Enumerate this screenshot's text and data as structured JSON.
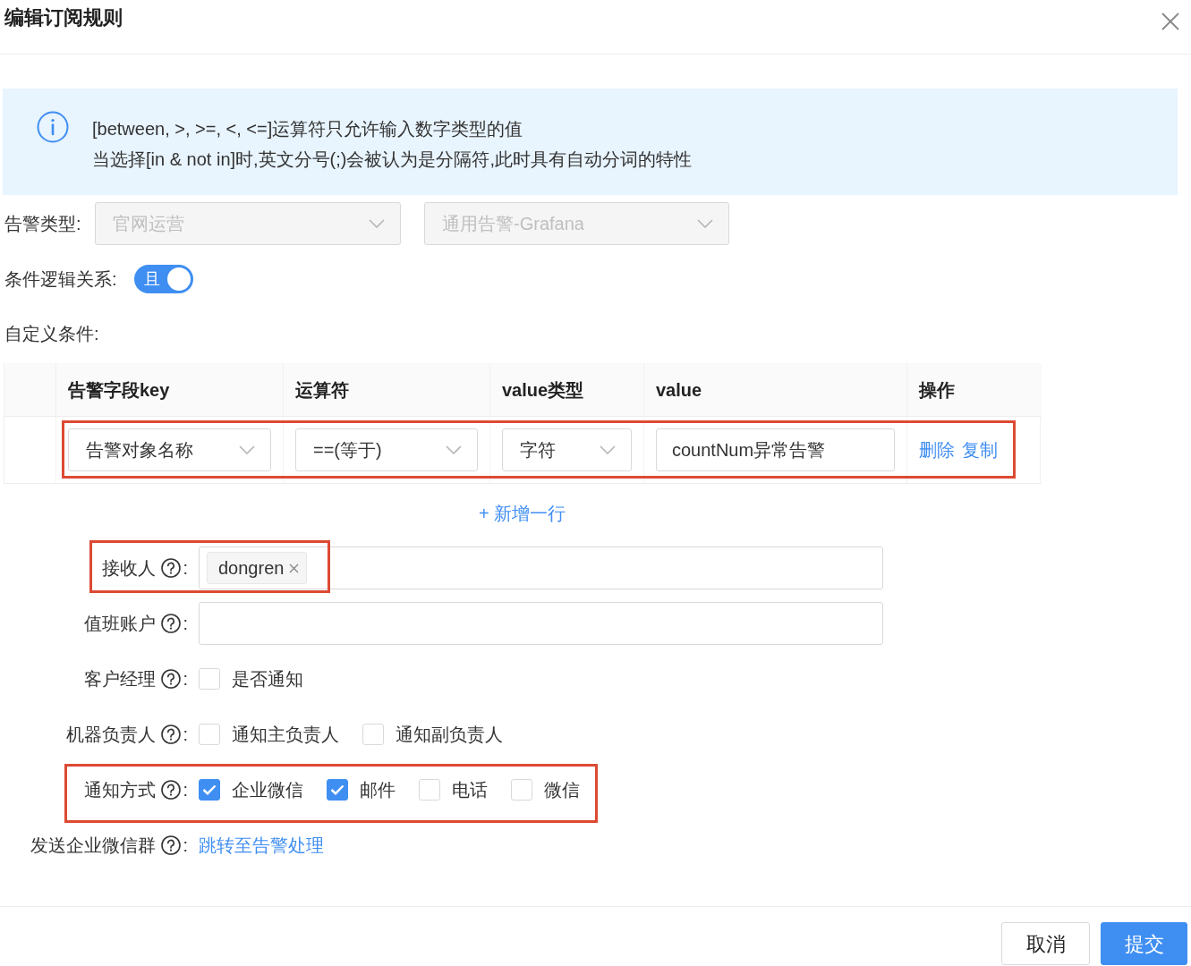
{
  "dialog": {
    "title": "编辑订阅规则"
  },
  "alert": {
    "lines": [
      "[between, >, >=, <, <=]运算符只允许输入数字类型的值",
      "当选择[in & not in]时,英文分号(;)会被认为是分隔符,此时具有自动分词的特性"
    ]
  },
  "alert_type": {
    "label": "告警类型:",
    "selects": [
      {
        "value": "官网运营",
        "disabled": true
      },
      {
        "value": "通用告警-Grafana",
        "disabled": true
      }
    ]
  },
  "logic": {
    "label": "条件逻辑关系:",
    "switch": {
      "text": "且",
      "on": true
    }
  },
  "conditions": {
    "label": "自定义条件:",
    "columns": [
      "告警字段key",
      "运算符",
      "value类型",
      "value",
      "操作"
    ],
    "rows": [
      {
        "highlighted": true,
        "field": "告警对象名称",
        "operator": "==(等于)",
        "value_type": "字符",
        "value": "countNum异常告警",
        "actions": [
          "删除",
          "复制"
        ]
      }
    ],
    "add_row": "+ 新增一行"
  },
  "form": [
    {
      "kind": "tags",
      "label": "接收人",
      "suffix": ":",
      "highlighted": true,
      "tags": [
        "dongren"
      ]
    },
    {
      "kind": "input",
      "label": "值班账户",
      "suffix": ":",
      "highlighted": false
    },
    {
      "kind": "checkboxes",
      "label": "客户经理",
      "suffix": ":",
      "highlighted": false,
      "options": [
        {
          "label": "是否通知",
          "checked": false
        }
      ]
    },
    {
      "kind": "checkboxes",
      "label": "机器负责人",
      "suffix": ":",
      "highlighted": false,
      "options": [
        {
          "label": "通知主负责人",
          "checked": false
        },
        {
          "label": "通知副负责人",
          "checked": false
        }
      ]
    },
    {
      "kind": "checkboxes",
      "label": "通知方式",
      "suffix": ":",
      "highlighted": true,
      "options": [
        {
          "label": "企业微信",
          "checked": true
        },
        {
          "label": "邮件",
          "checked": true
        },
        {
          "label": "电话",
          "checked": false
        },
        {
          "label": "微信",
          "checked": false
        }
      ]
    },
    {
      "kind": "link",
      "label": "发送企业微信群",
      "suffix": ":",
      "highlighted": false,
      "link": "跳转至告警处理"
    }
  ],
  "footer": {
    "buttons": [
      {
        "label": "取消",
        "kind": "default"
      },
      {
        "label": "提交",
        "kind": "primary"
      }
    ]
  }
}
